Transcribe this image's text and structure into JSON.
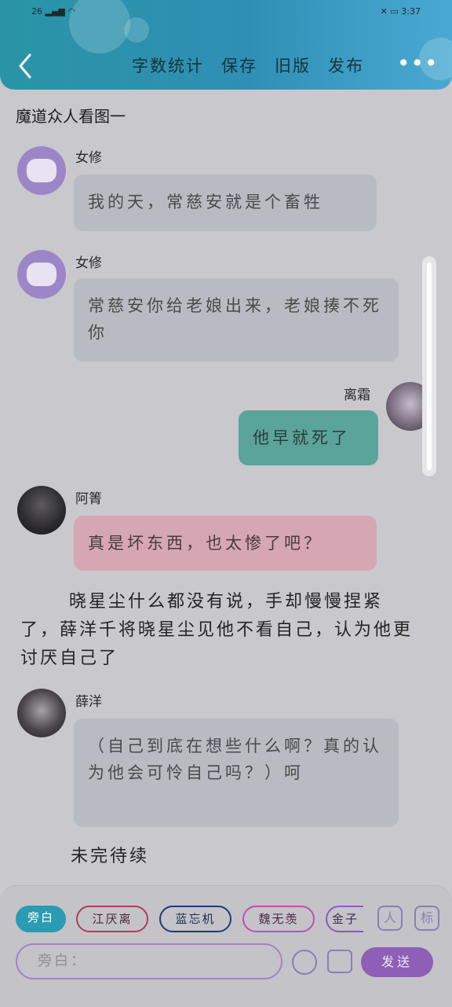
{
  "status": {
    "network": "26",
    "battery_time": "3:37"
  },
  "header": {
    "actions": [
      "字数统计",
      "保存",
      "旧版",
      "发布"
    ],
    "more": "•••"
  },
  "doc": {
    "title": "魔道众人看图一"
  },
  "messages": [
    {
      "name": "女修",
      "text": "我的天，常慈安就是个畜牲"
    },
    {
      "name": "女修",
      "text": "常慈安你给老娘出来，老娘揍不死你"
    },
    {
      "name": "离霜",
      "text": "他早就死了"
    },
    {
      "name": "阿箐",
      "text": "真是坏东西，也太惨了吧？"
    },
    {
      "name": "薛洋",
      "text": "（自己到底在想些什么啊？真的认为他会可怜自己吗？）呵"
    }
  ],
  "narration": [
    "晓星尘什么都没有说，手却慢慢捏紧了，薛洋千将晓星尘见他不看自己，认为他更讨厌自己了",
    "未完待续"
  ],
  "bottom": {
    "chips": [
      "旁白",
      "江厌离",
      "蓝忘机",
      "魏无羡",
      "金子"
    ],
    "input_placeholder": "旁白：",
    "send_label": "发送",
    "icon_person": "人",
    "icon_tag": "标"
  },
  "colors": {
    "header": "#2f8fb4",
    "active_chip": "#2a9bb3",
    "send": "#8d5fb6",
    "chip_borders": [
      "#2a9bb3",
      "#b23a5a",
      "#1e3a7a",
      "#c04fb0",
      "#8a5bc0"
    ]
  }
}
